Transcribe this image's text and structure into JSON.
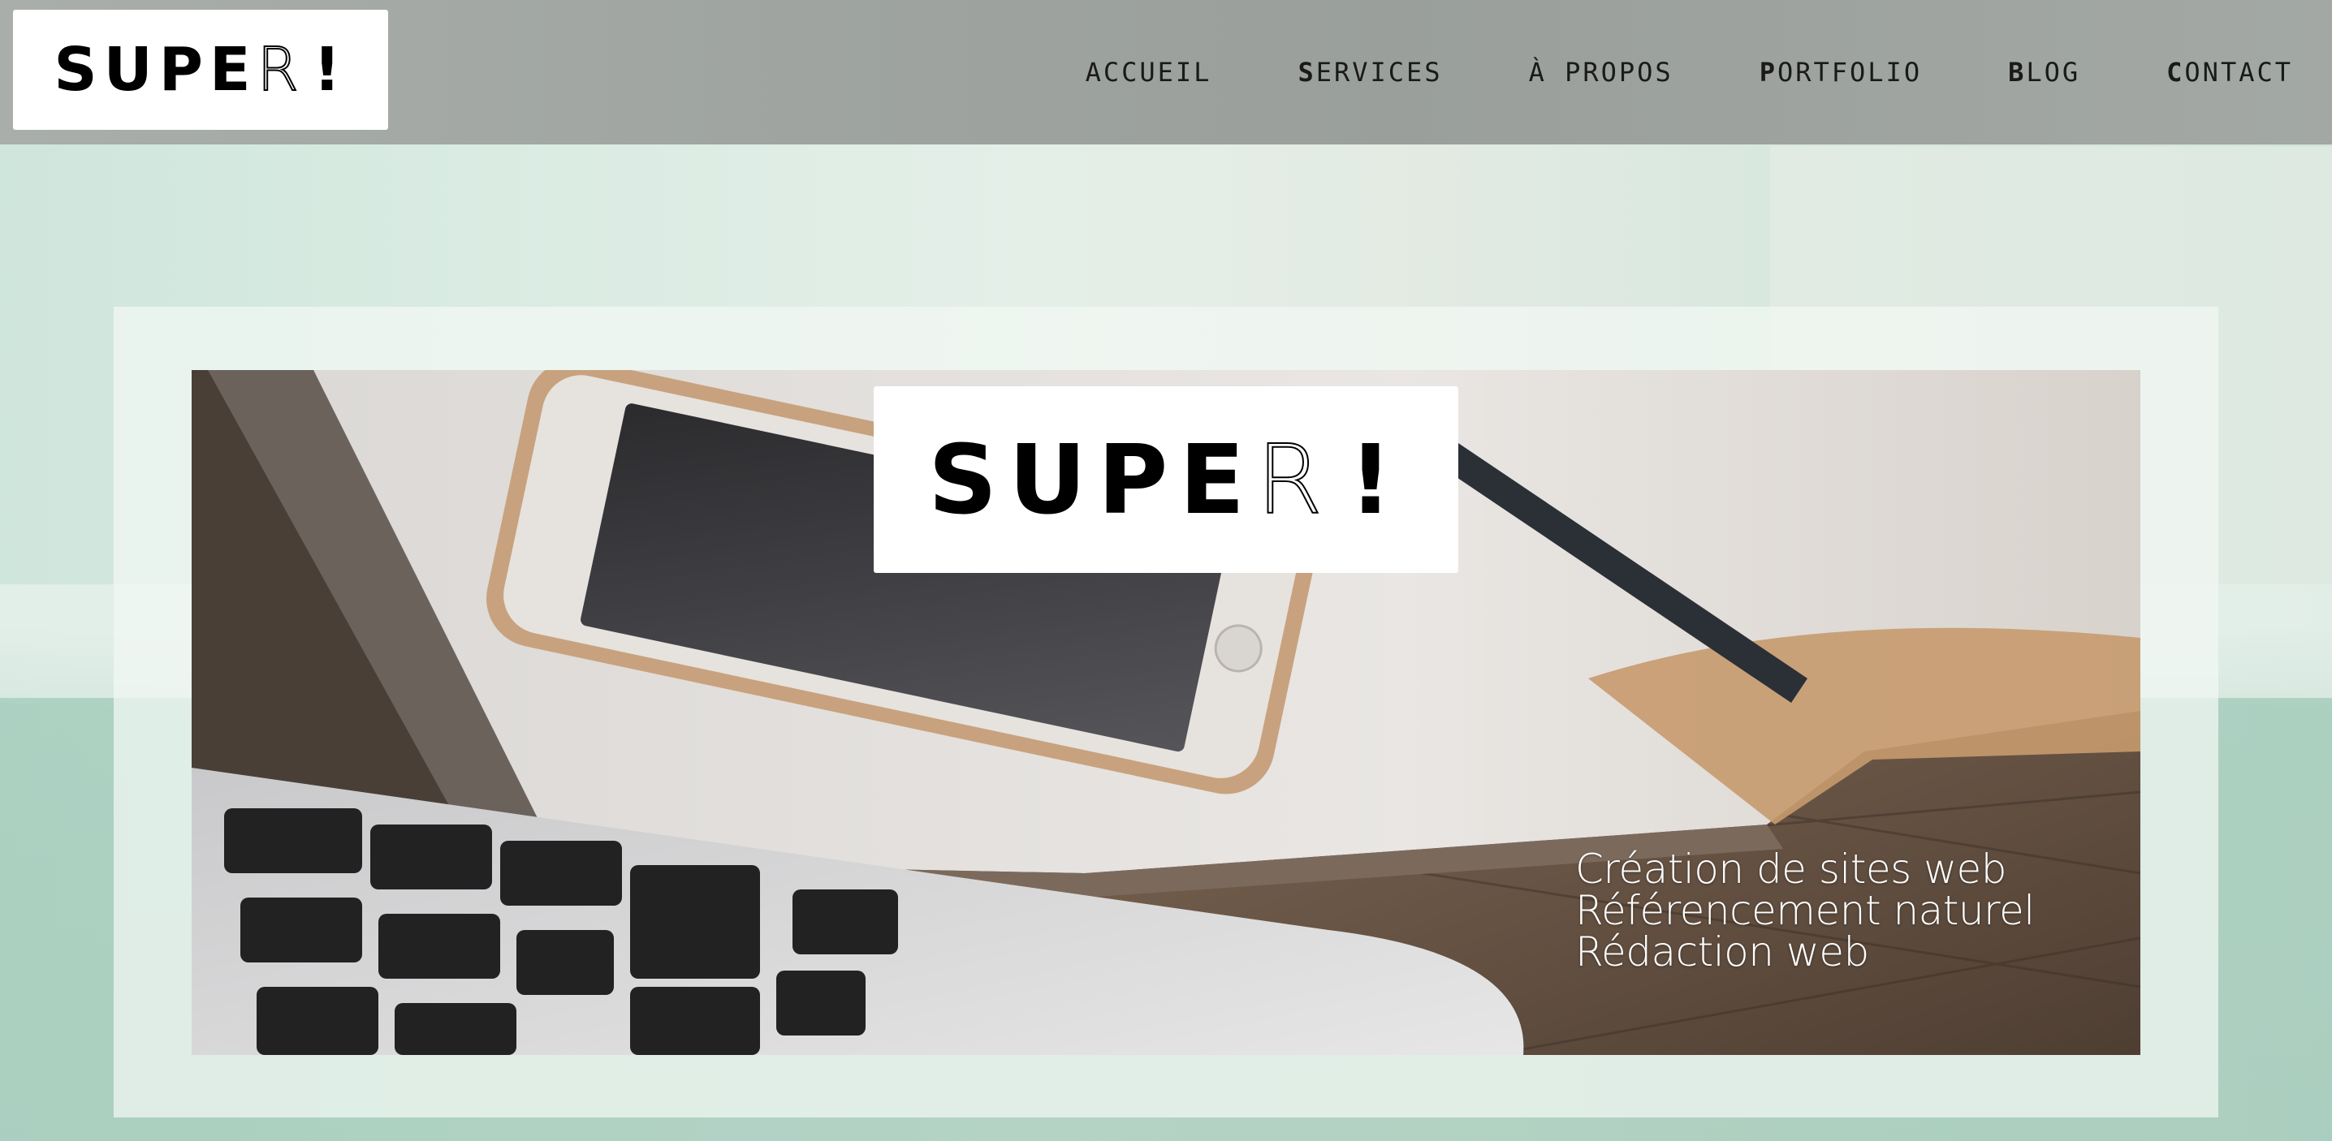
{
  "header": {
    "logo": {
      "solid": "SUPE",
      "outline": "R",
      "bang": "!"
    },
    "nav": [
      {
        "first": "A",
        "rest": "CCUEIL"
      },
      {
        "first": "S",
        "rest": "ERVICES"
      },
      {
        "first": "À",
        "rest": " PROPOS"
      },
      {
        "first": "P",
        "rest": "ORTFOLIO"
      },
      {
        "first": "B",
        "rest": "LOG"
      },
      {
        "first": "C",
        "rest": "ONTACT"
      }
    ]
  },
  "hero": {
    "logo": {
      "solid": "SUPE",
      "outline": "R",
      "bang": "!"
    },
    "taglines": [
      "Création de sites web",
      "Référencement naturel",
      "Rédaction web"
    ]
  },
  "colors": {
    "header_bg": "#9fa4a0",
    "page_bg": "#dbece3",
    "frame_bg": "#f3f8f4",
    "logo_bg": "#ffffff",
    "text_dark": "#1a1a1a",
    "tagline": "#ffffff"
  }
}
